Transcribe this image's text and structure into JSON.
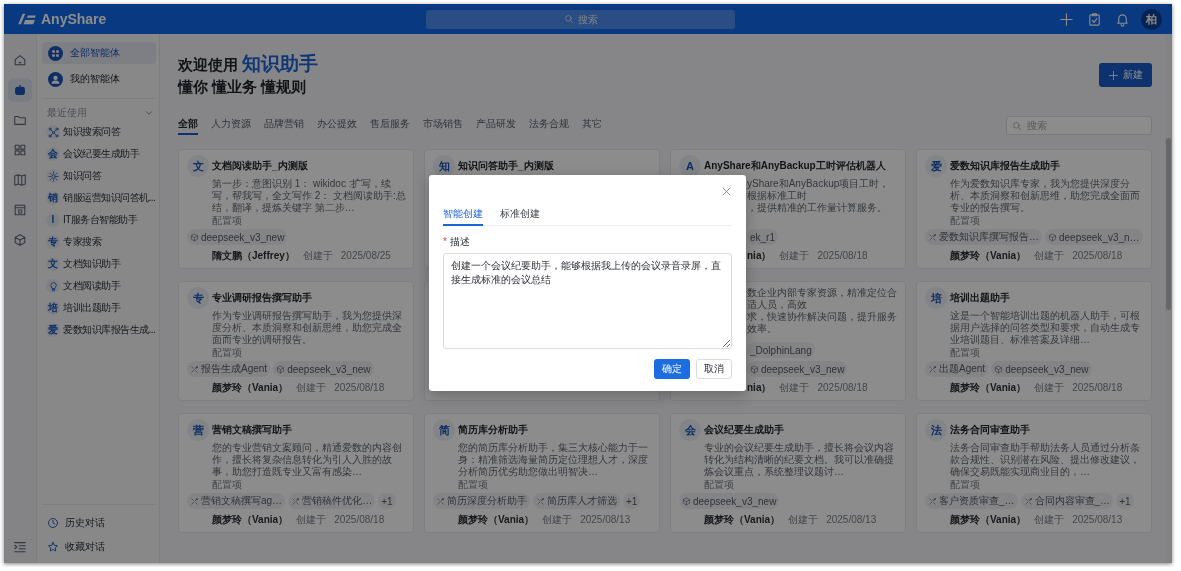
{
  "header": {
    "logo_text": "AnyShare",
    "search_placeholder": "搜索",
    "avatar": "柏"
  },
  "rail": [
    {
      "selected": false
    },
    {
      "selected": true
    },
    {
      "selected": false
    },
    {
      "selected": false
    },
    {
      "selected": false
    },
    {
      "selected": false
    },
    {
      "selected": false
    }
  ],
  "sidebar": {
    "items": [
      {
        "label": "全部智能体",
        "selected": true
      },
      {
        "label": "我的智能体",
        "selected": false
      }
    ],
    "recent_title": "最近使用",
    "recent_expanded": true,
    "recent": [
      {
        "kind": "network",
        "label": "知识搜索问答"
      },
      {
        "kind": "letter",
        "badge": "会",
        "label": "会议纪要生成助手"
      },
      {
        "kind": "gear",
        "label": "知识问答"
      },
      {
        "kind": "letter",
        "badge": "销",
        "label": "销服运营知识问答机..."
      },
      {
        "kind": "letter",
        "badge": "I",
        "label": "IT服务台智能助手"
      },
      {
        "kind": "letter",
        "badge": "专",
        "label": "专家搜索"
      },
      {
        "kind": "letter",
        "badge": "文",
        "label": "文档知识助手"
      },
      {
        "kind": "bulb",
        "label": "文档阅读助手"
      },
      {
        "kind": "letter",
        "badge": "培",
        "label": "培训出题助手"
      },
      {
        "kind": "letter",
        "badge": "爱",
        "label": "爱数知识库报告生成..."
      }
    ],
    "footer": [
      {
        "kind": "history",
        "label": "历史对话"
      },
      {
        "kind": "favorite",
        "label": "收藏对话"
      }
    ]
  },
  "main": {
    "title": "欢迎使用",
    "title_highlight": "知识助手",
    "subtitle": "懂你 懂业务 懂规则",
    "new_button": "新建",
    "tabs": [
      {
        "label": "全部",
        "selected": true
      },
      {
        "label": "人力资源",
        "selected": false
      },
      {
        "label": "品牌营销",
        "selected": false
      },
      {
        "label": "办公提效",
        "selected": false
      },
      {
        "label": "售后服务",
        "selected": false
      },
      {
        "label": "市场销售",
        "selected": false
      },
      {
        "label": "产品研发",
        "selected": false
      },
      {
        "label": "法务合规",
        "selected": false
      },
      {
        "label": "其它",
        "selected": false
      }
    ],
    "search_placeholder": "搜索",
    "cards": [
      {
        "kind": "full",
        "icon": "文",
        "title": "文档阅读助手_内测版",
        "desc": "第一步：意图识别 1： wikidoc :扩写，续写，帮我写，全文写作 2： 文档阅读助手:总结，翻译，提炼关键字 第二步…",
        "config_label": "配置项",
        "tags": [
          {
            "kind": "model",
            "label": "deepseek_v3_new"
          }
        ],
        "author": "隋文鹏（Jeffrey）",
        "created_label": "创建于",
        "date": "2025/08/25"
      },
      {
        "kind": "full",
        "icon": "知",
        "title": "知识问答助手_内测版"
      },
      {
        "kind": "covered",
        "icon": "A",
        "title": "AnyShare和AnyBackup工时评估机器人",
        "desc_fragments": [
          "yShare和AnyBackup项目工时，根据标准工时",
          "，提供精准的工作量计算服务。"
        ],
        "tags": [
          {
            "kind": "clipped",
            "label": "ek_r1"
          }
        ],
        "author": "nia）",
        "created_label": "创建于",
        "date": "2025/08/18"
      },
      {
        "kind": "full",
        "icon": "爱",
        "title": "爱数知识库报告生成助手",
        "desc": "作为爱数知识库专家，我为您提供深度分析、本质洞察和创新思维，助您完成全面而专业的报告撰写。",
        "config_label": "配置项",
        "tags": [
          {
            "kind": "agent",
            "label": "爱数知识库撰写报告…"
          },
          {
            "kind": "model",
            "label": "deepseek_v3_n…"
          }
        ],
        "author": "颜梦玲（Vania）",
        "created_label": "创建于",
        "date": "2025/08/18"
      },
      {
        "kind": "full",
        "icon": "专",
        "title": "专业调研报告撰写助手",
        "desc": "作为专业调研报告撰写助手，我为您提供深度分析、本质洞察和创新思维，助您完成全面而专业的调研报告。",
        "config_label": "配置项",
        "tags": [
          {
            "kind": "agent",
            "label": "报告生成Agent"
          },
          {
            "kind": "model",
            "label": "deepseek_v3_new"
          }
        ],
        "author": "颜梦玲（Vania）",
        "created_label": "创建于",
        "date": "2025/08/18"
      },
      {
        "kind": "covered"
      },
      {
        "kind": "covered",
        "desc_fragments": [
          "数企业内部专家资源，精准定位合适人员，高效",
          "求，快速协作解决问题，提升服务效率。"
        ],
        "tags": [
          {
            "kind": "clipped",
            "label": "_DolphinLang"
          },
          {
            "kind": "model",
            "label": "deepseek_v3_new"
          }
        ],
        "author": "nia）",
        "created_label": "创建于",
        "date": "2025/08/18"
      },
      {
        "kind": "full",
        "icon": "培",
        "title": "培训出题助手",
        "desc": "这是一个智能培训出题的机器人助手，可根据用户选择的问答类型和要求，自动生成专业培训题目、标准答案及详细…",
        "config_label": "配置项",
        "tags": [
          {
            "kind": "agent",
            "label": "出题Agent"
          },
          {
            "kind": "model",
            "label": "deepseek_v3_new"
          }
        ],
        "author": "颜梦玲（Vania）",
        "created_label": "创建于",
        "date": "2025/08/18"
      },
      {
        "kind": "full",
        "icon": "营",
        "title": "营销文稿撰写助手",
        "desc": "您的专业营销文案顾问，精通爱数的内容创作，擅长将复杂信息转化为引人入胜的故事，助您打造既专业又富有感染…",
        "config_label": "配置项",
        "tags": [
          {
            "kind": "agent",
            "label": "营销文稿撰写ag…"
          },
          {
            "kind": "agent",
            "label": "营销稿件优化…"
          },
          {
            "kind": "more",
            "label": "+1"
          }
        ],
        "author": "颜梦玲（Vania）",
        "created_label": "创建于",
        "date": "2025/08/18"
      },
      {
        "kind": "full",
        "icon": "简",
        "title": "简历库分析助手",
        "desc": "您的简历库分析助手，集三大核心能力于一身：精准筛选海量简历定位理想人才，深度分析简历优劣助您做出明智决…",
        "config_label": "配置项",
        "tags": [
          {
            "kind": "agent",
            "label": "简历深度分析助手"
          },
          {
            "kind": "agent",
            "label": "简历库人才筛选"
          },
          {
            "kind": "more",
            "label": "+1"
          }
        ],
        "author": "颜梦玲（Vania）",
        "created_label": "创建于",
        "date": "2025/08/13"
      },
      {
        "kind": "full",
        "icon": "会",
        "title": "会议纪要生成助手",
        "desc": "专业的会议纪要生成助手，擅长将会议内容转化为结构清晰的纪要文档。我可以准确提炼会议重点，系统整理议题讨…",
        "config_label": "配置项",
        "tags": [
          {
            "kind": "model",
            "label": "deepseek_v3_new"
          }
        ],
        "author": "颜梦玲（Vania）",
        "created_label": "创建于",
        "date": "2025/08/13"
      },
      {
        "kind": "full",
        "icon": "法",
        "title": "法务合同审查助手",
        "desc": "法务合同审查助手帮助法务人员通过分析条款合规性、识别潜在风险、提出修改建议，确保交易既能实现商业目的，…",
        "config_label": "配置项",
        "tags": [
          {
            "kind": "agent",
            "label": "客户资质审查_…"
          },
          {
            "kind": "agent",
            "label": "合同内容审查_…"
          },
          {
            "kind": "more",
            "label": "+1"
          }
        ],
        "author": "颜梦玲（Vania）",
        "created_label": "创建于",
        "date": "2025/08/13"
      }
    ]
  },
  "modal": {
    "tabs": [
      {
        "label": "智能创建",
        "selected": true
      },
      {
        "label": "标准创建",
        "selected": false
      }
    ],
    "field_label": "描述",
    "required_mark": "*",
    "value": "创建一个会议纪要助手，能够根据我上传的会议录音录屏，直接生成标准的会议总结",
    "confirm": "确定",
    "cancel": "取消"
  }
}
